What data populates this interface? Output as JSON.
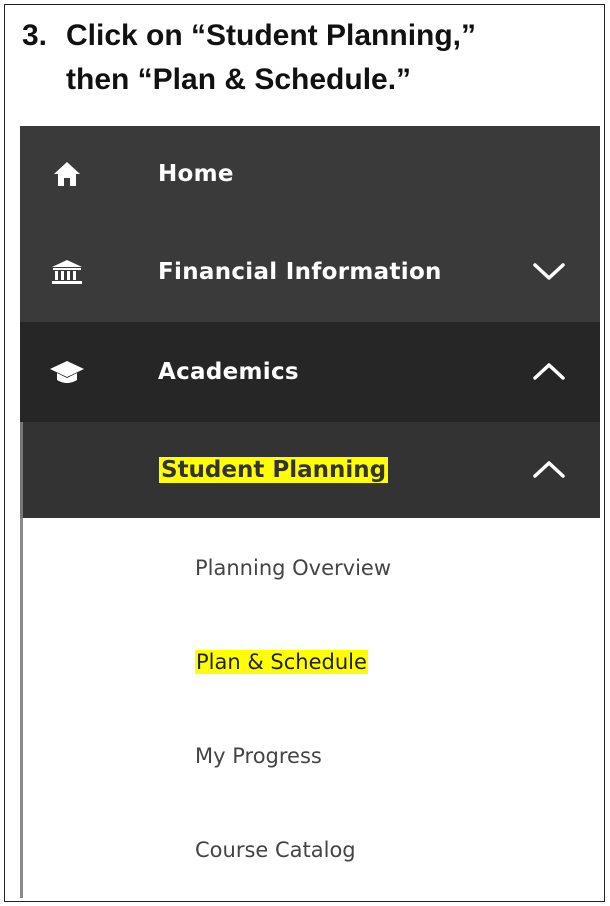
{
  "instruction": {
    "number": "3.",
    "line1": "Click on “Student Planning,”",
    "line2": "then “Plan & Schedule.”"
  },
  "nav": {
    "items": [
      {
        "label": "Home",
        "icon": "home-icon"
      },
      {
        "label": "Financial Information",
        "icon": "bank-icon",
        "chevron": "chevron-down-icon"
      },
      {
        "label": "Academics",
        "icon": "graduation-cap-icon",
        "chevron": "chevron-up-icon"
      }
    ],
    "submenu": {
      "label": "Student Planning",
      "chevron": "chevron-up-icon",
      "highlight_color": "#ffff00",
      "items": [
        {
          "label": "Planning Overview"
        },
        {
          "label": "Plan & Schedule",
          "highlighted": true
        },
        {
          "label": "My Progress"
        },
        {
          "label": "Course Catalog"
        }
      ]
    }
  },
  "colors": {
    "nav_dark": "#3a3a3a",
    "nav_darker": "#262626",
    "highlight": "#ffff00"
  }
}
